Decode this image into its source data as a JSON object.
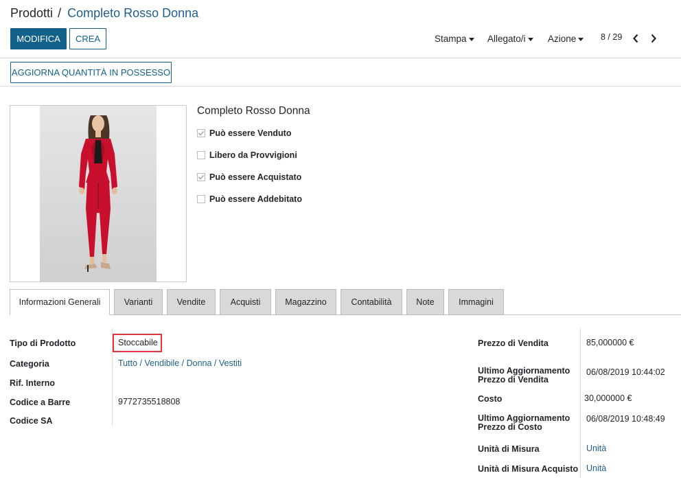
{
  "breadcrumb": {
    "root": "Prodotti",
    "separator": "/",
    "current": "Completo Rosso Donna"
  },
  "buttons": {
    "edit": "MODIFICA",
    "create": "CREA",
    "update_qty": "AGGIORNA QUANTITÀ IN POSSESSO"
  },
  "menus": {
    "print": "Stampa",
    "attachments": "Allegato/i",
    "action": "Azione"
  },
  "pager": {
    "value": "8 / 29"
  },
  "product": {
    "name": "Completo Rosso Donna",
    "image_icon": "product-photo-red-suit",
    "checkboxes": [
      {
        "label": "Può essere Venduto",
        "checked": true
      },
      {
        "label": "Libero da Provvigioni",
        "checked": false
      },
      {
        "label": "Può essere Acquistato",
        "checked": true
      },
      {
        "label": "Può essere Addebitato",
        "checked": false
      }
    ]
  },
  "tabs": [
    {
      "label": "Informazioni Generali",
      "active": true
    },
    {
      "label": "Varianti",
      "active": false
    },
    {
      "label": "Vendite",
      "active": false
    },
    {
      "label": "Acquisti",
      "active": false
    },
    {
      "label": "Magazzino",
      "active": false
    },
    {
      "label": "Contabilità",
      "active": false
    },
    {
      "label": "Note",
      "active": false
    },
    {
      "label": "Immagini",
      "active": false
    }
  ],
  "left_fields": [
    {
      "label": "Tipo di Prodotto",
      "value": "Stoccabile"
    },
    {
      "label": "Categoria",
      "value": "Tutto / Vendibile / Donna / Vestiti"
    },
    {
      "label": "Rif. Interno",
      "value": ""
    },
    {
      "label": "Codice a Barre",
      "value": "9772735518808"
    },
    {
      "label": "Codice SA",
      "value": ""
    }
  ],
  "right_fields": [
    {
      "label": "Prezzo di Vendita",
      "value": "85,000000 €"
    },
    {
      "label_line1": "Ultimo Aggiornamento",
      "label_line2": "Prezzo di Vendita",
      "value": "06/08/2019 10:44:02"
    },
    {
      "label": "Costo",
      "value": "30,000000 €"
    },
    {
      "label_line1": "Ultimo Aggiornamento",
      "label_line2": "Prezzo di Costo",
      "value": "06/08/2019 10:48:49"
    },
    {
      "label": "Unità di Misura",
      "value": "Unità"
    },
    {
      "label": "Unità di Misura Acquisto",
      "value": "Unità"
    }
  ],
  "colors": {
    "primary": "#11618a",
    "link": "#1f5f87",
    "highlight": "#e0343e",
    "suit": "#c8102e"
  }
}
